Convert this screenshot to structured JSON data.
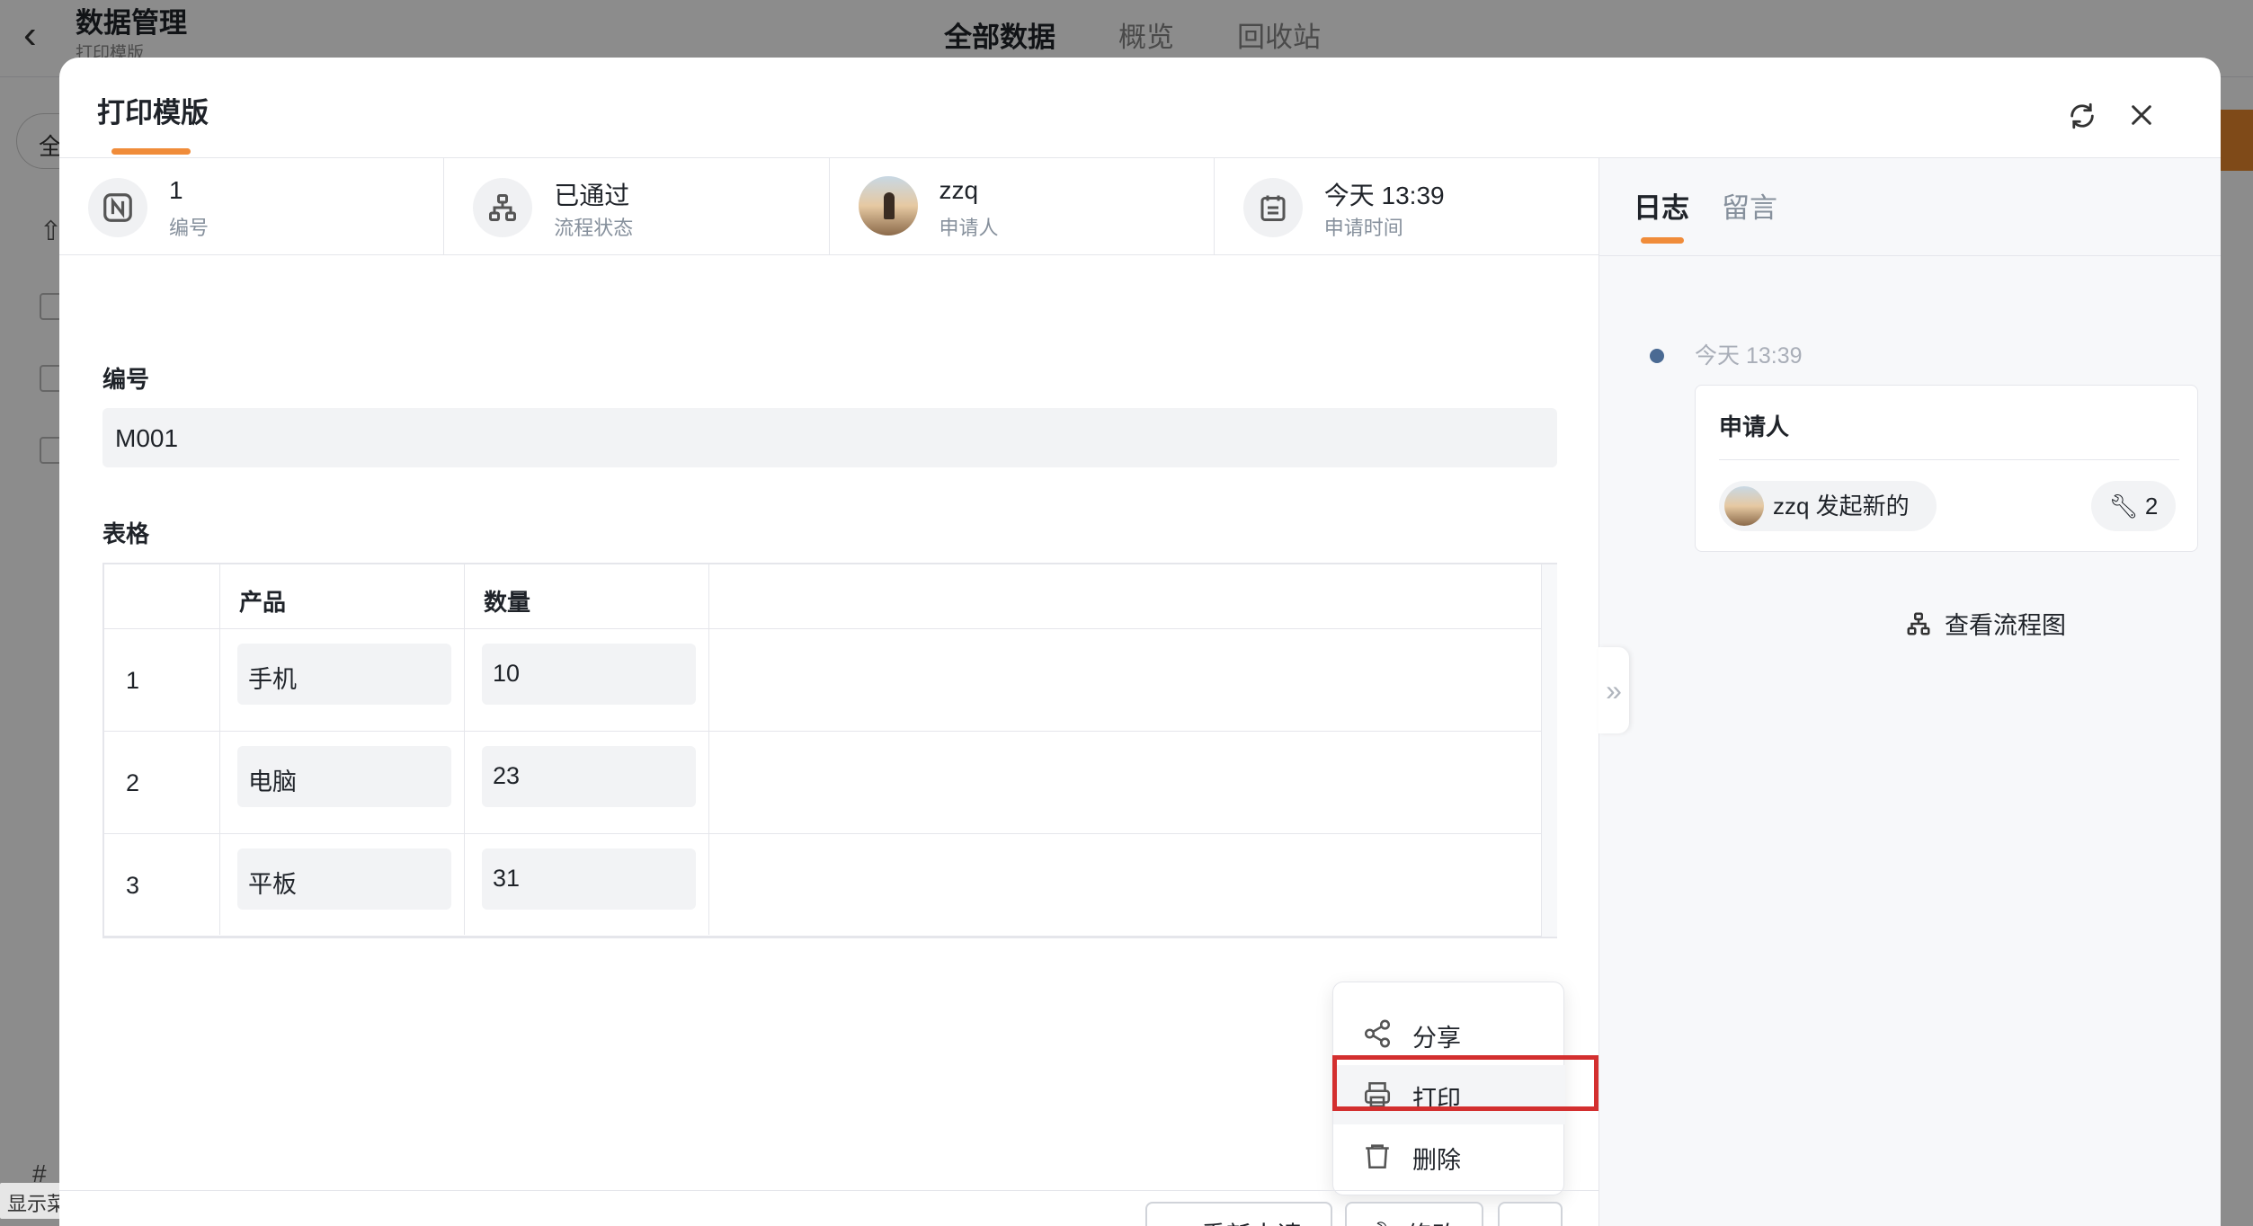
{
  "background": {
    "title": "数据管理",
    "subtitle": "打印模版",
    "tabs": [
      "全部数据",
      "概览",
      "回收站"
    ],
    "filter_label": "全",
    "hash": "#",
    "show_menu": "显示菜单"
  },
  "modal": {
    "title": "打印模版",
    "info": [
      {
        "value": "1",
        "label": "编号",
        "icon": "number-icon"
      },
      {
        "value": "已通过",
        "label": "流程状态",
        "icon": "flow-icon"
      },
      {
        "value": "zzq",
        "label": "申请人",
        "icon": "avatar"
      },
      {
        "value": "今天 13:39",
        "label": "申请时间",
        "icon": "calendar-icon"
      }
    ],
    "field_number_label": "编号",
    "field_number_value": "M001",
    "table_label": "表格",
    "table": {
      "headers": [
        "产品",
        "数量"
      ],
      "rows": [
        {
          "index": "1",
          "product": "手机",
          "qty": "10"
        },
        {
          "index": "2",
          "product": "电脑",
          "qty": "23"
        },
        {
          "index": "3",
          "product": "平板",
          "qty": "31"
        }
      ]
    },
    "footer": {
      "resubmit": "重新申请",
      "edit": "修改",
      "more": "···"
    },
    "menu": {
      "share": "分享",
      "print": "打印",
      "delete": "删除"
    }
  },
  "side": {
    "tabs": [
      "日志",
      "留言"
    ],
    "log_time": "今天 13:39",
    "card_title": "申请人",
    "user_action": "zzq 发起新的",
    "count": "2",
    "flow_link": "查看流程图"
  },
  "colors": {
    "accent": "#f08c3a",
    "highlight_border": "#d32f2f"
  }
}
